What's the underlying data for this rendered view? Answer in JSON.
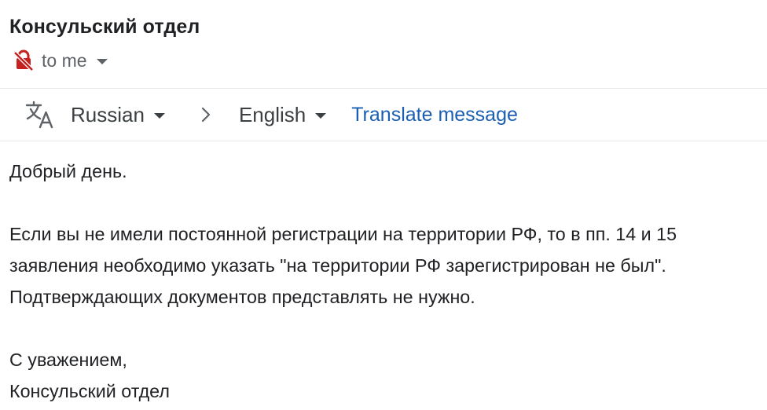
{
  "message": {
    "sender_name": "Консульский отдел",
    "recipient_label": "to me"
  },
  "translate_bar": {
    "source_language": "Russian",
    "target_language": "English",
    "translate_link": "Translate message"
  },
  "body": {
    "greeting": "Добрый день.",
    "paragraph_lines": [
      "Если вы не имели постоянной регистрации на территории РФ, то в пп. 14 и 15",
      "заявления необходимо указать \"на территории РФ зарегистрирован не был\".",
      "Подтверждающих документов представлять не нужно."
    ],
    "closing": "С уважением,",
    "signature": "Консульский отдел"
  },
  "icons": {
    "security": "unencrypted-lock-icon",
    "translate": "translate-icon",
    "arrow": "chevron-right-icon",
    "dropdown": "caret-down-icon"
  },
  "colors": {
    "link": "#1a5fb4",
    "lock_red": "#c5221f",
    "text": "#202124",
    "muted": "#5f6368"
  }
}
